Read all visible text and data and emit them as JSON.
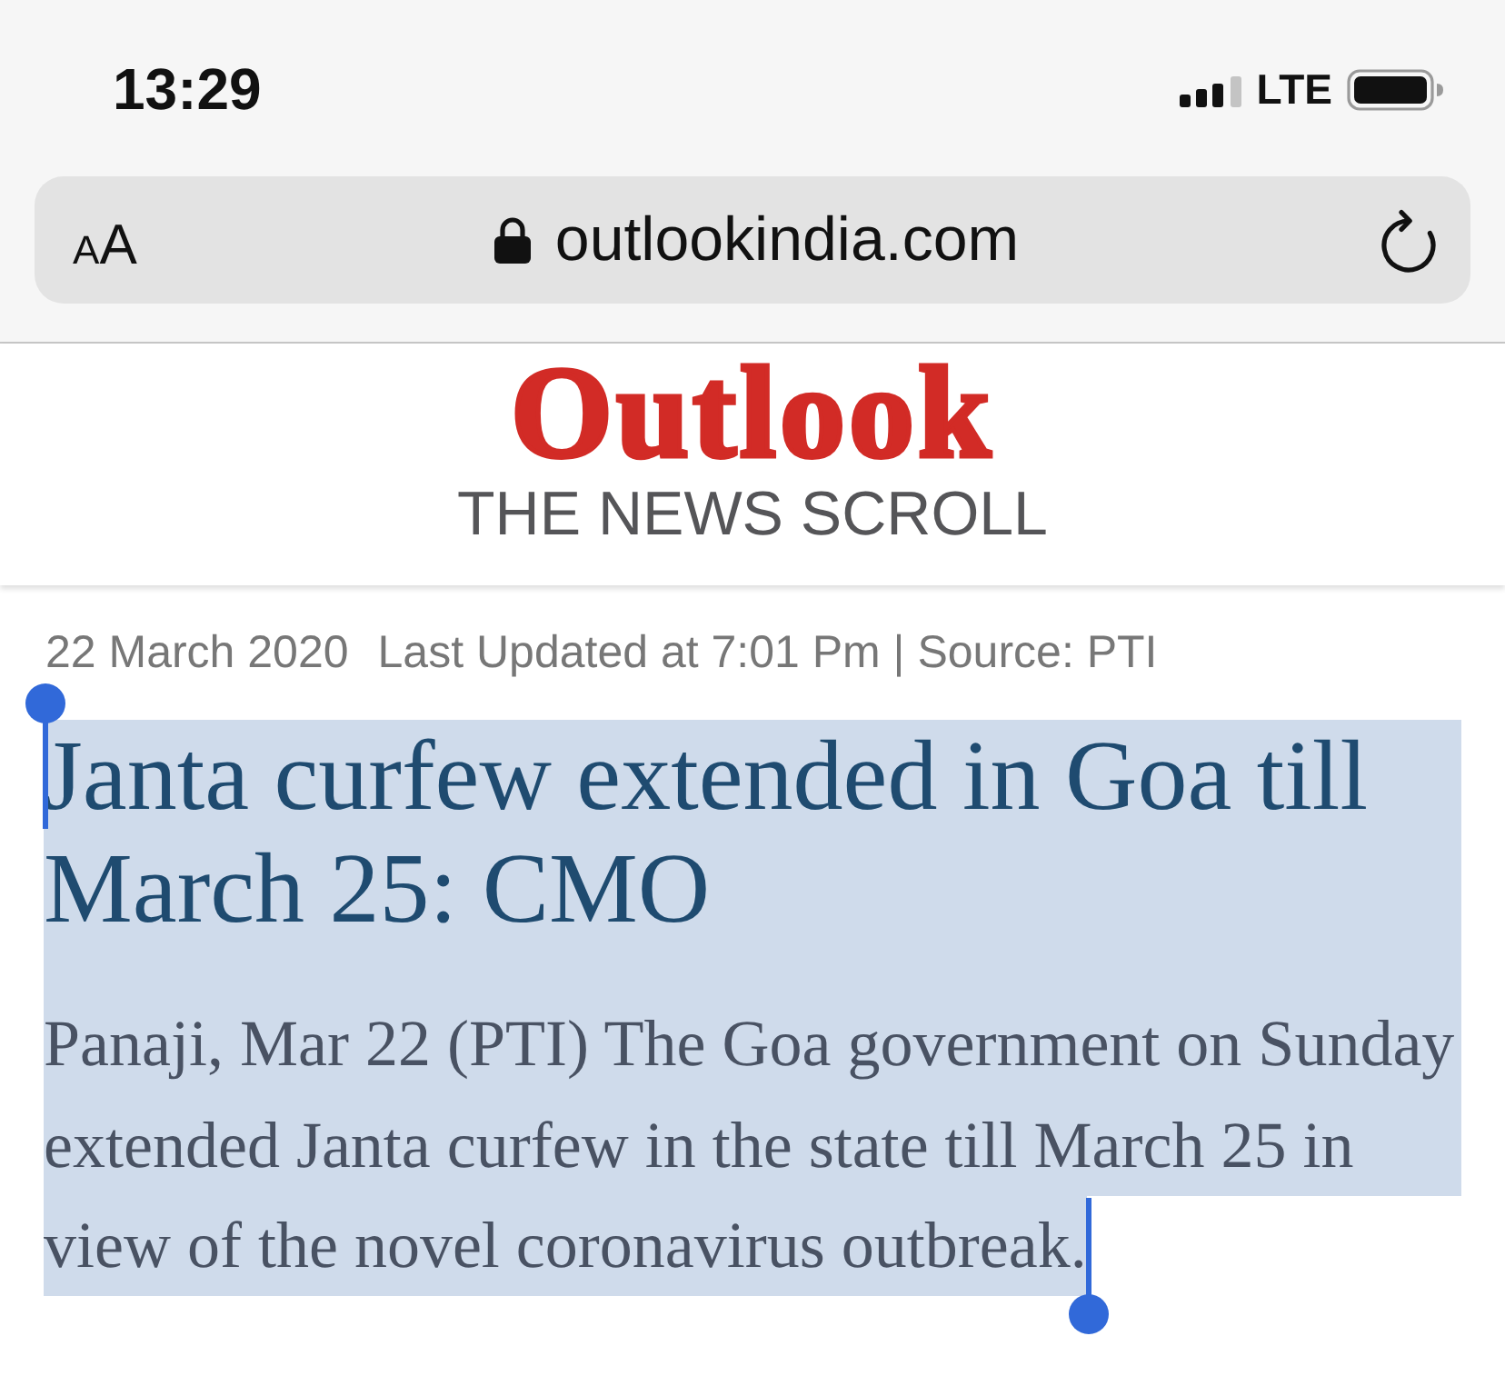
{
  "status_bar": {
    "time": "13:29",
    "network": "LTE"
  },
  "address_bar": {
    "text_size_button": {
      "small_letter": "A",
      "large_letter": "A"
    },
    "secure": true,
    "url": "outlookindia.com"
  },
  "site_header": {
    "logo": "Outlook",
    "tagline": "THE NEWS SCROLL"
  },
  "article": {
    "date": "22 March 2020",
    "updated": "Last Updated at 7:01 Pm | Source: PTI",
    "headline": {
      "text": "Janta curfew extended in Goa till March 25: CMO",
      "text_selected": true
    },
    "body": {
      "text": "Panaji, Mar 22 (PTI) The Goa government on Sunday extended Janta curfew in the state till March 25 in view of the novel coronavirus outbreak.",
      "text_selected": true
    }
  }
}
